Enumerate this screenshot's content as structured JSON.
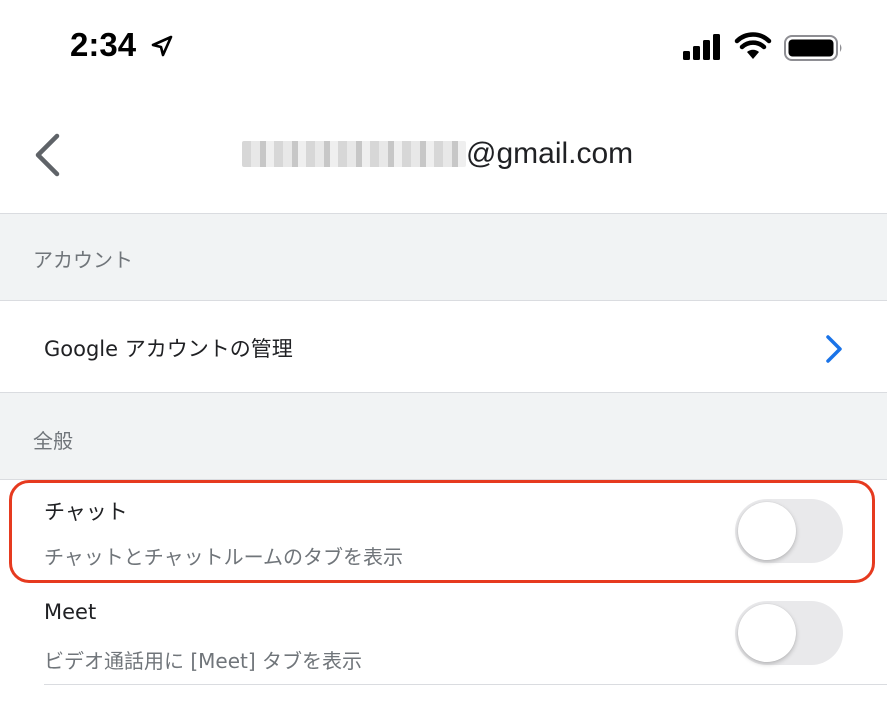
{
  "status_bar": {
    "time": "2:34",
    "icons": [
      "location-arrow-icon",
      "cellular-signal-icon",
      "wifi-icon",
      "battery-icon"
    ]
  },
  "header": {
    "back_icon": "chevron-left-icon",
    "email_domain": "@gmail.com",
    "email_username_masked": true
  },
  "sections": {
    "account": {
      "title": "アカウント"
    },
    "general": {
      "title": "全般"
    }
  },
  "manage_account": {
    "label": "Google アカウントの管理",
    "icon": "chevron-right-icon"
  },
  "settings": {
    "chat": {
      "title": "チャット",
      "description": "チャットとチャットルームのタブを表示",
      "enabled": false
    },
    "meet": {
      "title": "Meet",
      "description": "ビデオ通話用に [Meet] タブを表示",
      "enabled": false
    }
  },
  "colors": {
    "accent_chevron": "#1a73e8",
    "highlight": "#e63a1f",
    "toggle_off": "#e9e9eb",
    "section_bg": "#f1f3f4"
  }
}
